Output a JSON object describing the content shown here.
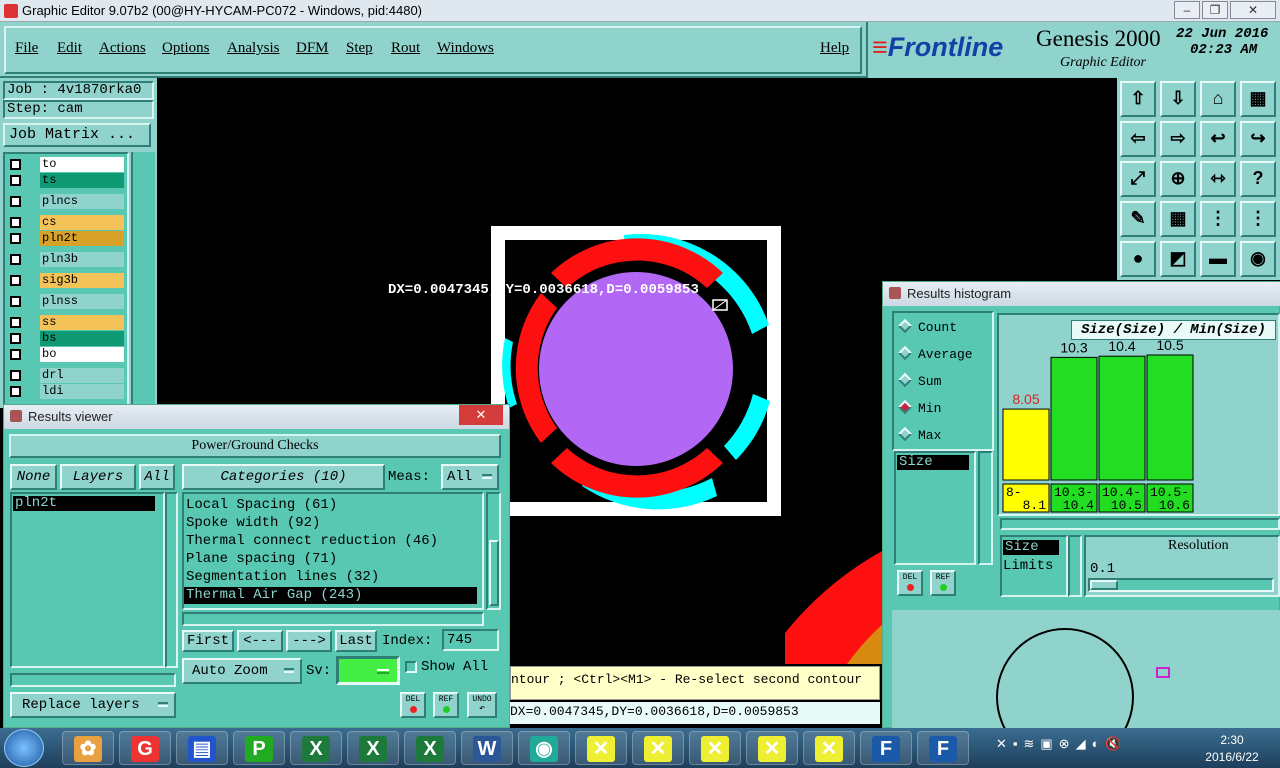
{
  "window": {
    "title": "Graphic Editor 9.07b2 (00@HY-HYCAM-PC072 - Windows, pid:4480)"
  },
  "menu": {
    "file": "File",
    "edit": "Edit",
    "actions": "Actions",
    "options": "Options",
    "analysis": "Analysis",
    "dfm": "DFM",
    "step": "Step",
    "rout": "Rout",
    "windows": "Windows",
    "help": "Help"
  },
  "brand": {
    "logo": "Frontline",
    "product": "Genesis 2000",
    "subtitle": "Graphic Editor",
    "date": "22 Jun 2016",
    "time": "02:23 AM"
  },
  "job": {
    "job_label": "Job : 4v1870rka0",
    "step_label": "Step: cam",
    "matrix_button": "Job Matrix ..."
  },
  "layers": [
    {
      "name": "to",
      "color": "#ffffff"
    },
    {
      "name": "ts",
      "color": "#0f9a73"
    },
    {
      "name": "plncs",
      "color": "#8fd3cc"
    },
    {
      "name": "cs",
      "color": "#f3c35a"
    },
    {
      "name": "pln2t",
      "color": "#d8a22a"
    },
    {
      "name": "pln3b",
      "color": "#8fd3cc"
    },
    {
      "name": "sig3b",
      "color": "#f3c35a"
    },
    {
      "name": "plnss",
      "color": "#8fd3cc"
    },
    {
      "name": "ss",
      "color": "#f3c35a"
    },
    {
      "name": "bs",
      "color": "#0f9a73"
    },
    {
      "name": "bo",
      "color": "#ffffff"
    },
    {
      "name": "drl",
      "color": "#8fd3cc"
    },
    {
      "name": "ldi",
      "color": "#8fd3cc"
    }
  ],
  "canvas": {
    "measure_text": "DX=0.0047345,DY=0.0036618,D=0.0059853"
  },
  "status": {
    "hint": "ntour ; <Ctrl><M1> - Re-select second contour",
    "measure": "DX=0.0047345,DY=0.0036618,D=0.0059853"
  },
  "results_viewer": {
    "title": "Results viewer",
    "heading": "Power/Ground Checks",
    "none": "None",
    "layers": "Layers",
    "all": "All",
    "selected_layer": "pln2t",
    "categories_label": "Categories (10)",
    "meas_label": "Meas:",
    "meas_value": "All",
    "categories": [
      "Local Spacing (61)",
      "Spoke width (92)",
      "Thermal connect reduction (46)",
      "Plane spacing (71)",
      "Segmentation lines (32)",
      "Thermal Air Gap (243)"
    ],
    "first": "First",
    "prev": "<---",
    "next": "--->",
    "last": "Last",
    "index_label": "Index:",
    "index_value": "745",
    "auto_zoom": "Auto Zoom",
    "sv_label": "Sv:",
    "show_all": "Show All",
    "replace_layers": "Replace layers",
    "del": "DEL",
    "ref": "REF",
    "undo": "UNDO"
  },
  "histogram": {
    "title": "Results histogram",
    "modes": [
      "Count",
      "Average",
      "Sum",
      "Min",
      "Max"
    ],
    "selected_mode": "Min",
    "list_item": "Size",
    "chart_title": "Size(Size) / Min(Size)",
    "del": "DEL",
    "ref": "REF",
    "resolution_label": "Resolution",
    "resolution_value": "0.1",
    "size_label": "Size",
    "limits_label": "Limits"
  },
  "chart_data": {
    "type": "bar",
    "title": "Size(Size) / Min(Size)",
    "categories": [
      "8-8.1",
      "10.3-10.4",
      "10.4-10.5",
      "10.5-10.6"
    ],
    "values": [
      8.05,
      10.3,
      10.4,
      10.5
    ],
    "colors": [
      "#ffff00",
      "#22dd22",
      "#22dd22",
      "#22dd22"
    ]
  },
  "clock": {
    "time": "2:30",
    "date": "2016/6/22"
  }
}
